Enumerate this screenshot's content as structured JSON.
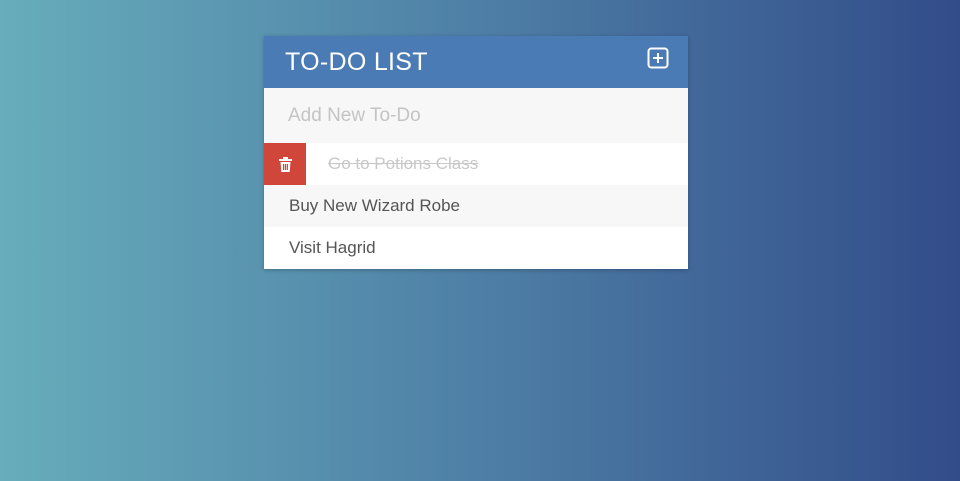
{
  "header": {
    "title": "TO-DO LIST",
    "add_icon": "plus-square-icon"
  },
  "new_todo": {
    "placeholder": "Add New To-Do",
    "value": ""
  },
  "todos": [
    {
      "text": "Go to Potions Class",
      "completed": true,
      "hovered": true
    },
    {
      "text": "Buy New Wizard Robe",
      "completed": false,
      "hovered": false
    },
    {
      "text": "Visit Hagrid",
      "completed": false,
      "hovered": false
    }
  ],
  "colors": {
    "header_bg": "#4a7bb5",
    "delete_bg": "#d0463a",
    "gradient_start": "#67adbb",
    "gradient_end": "#324c8a"
  },
  "delete_icon": "trash-icon"
}
